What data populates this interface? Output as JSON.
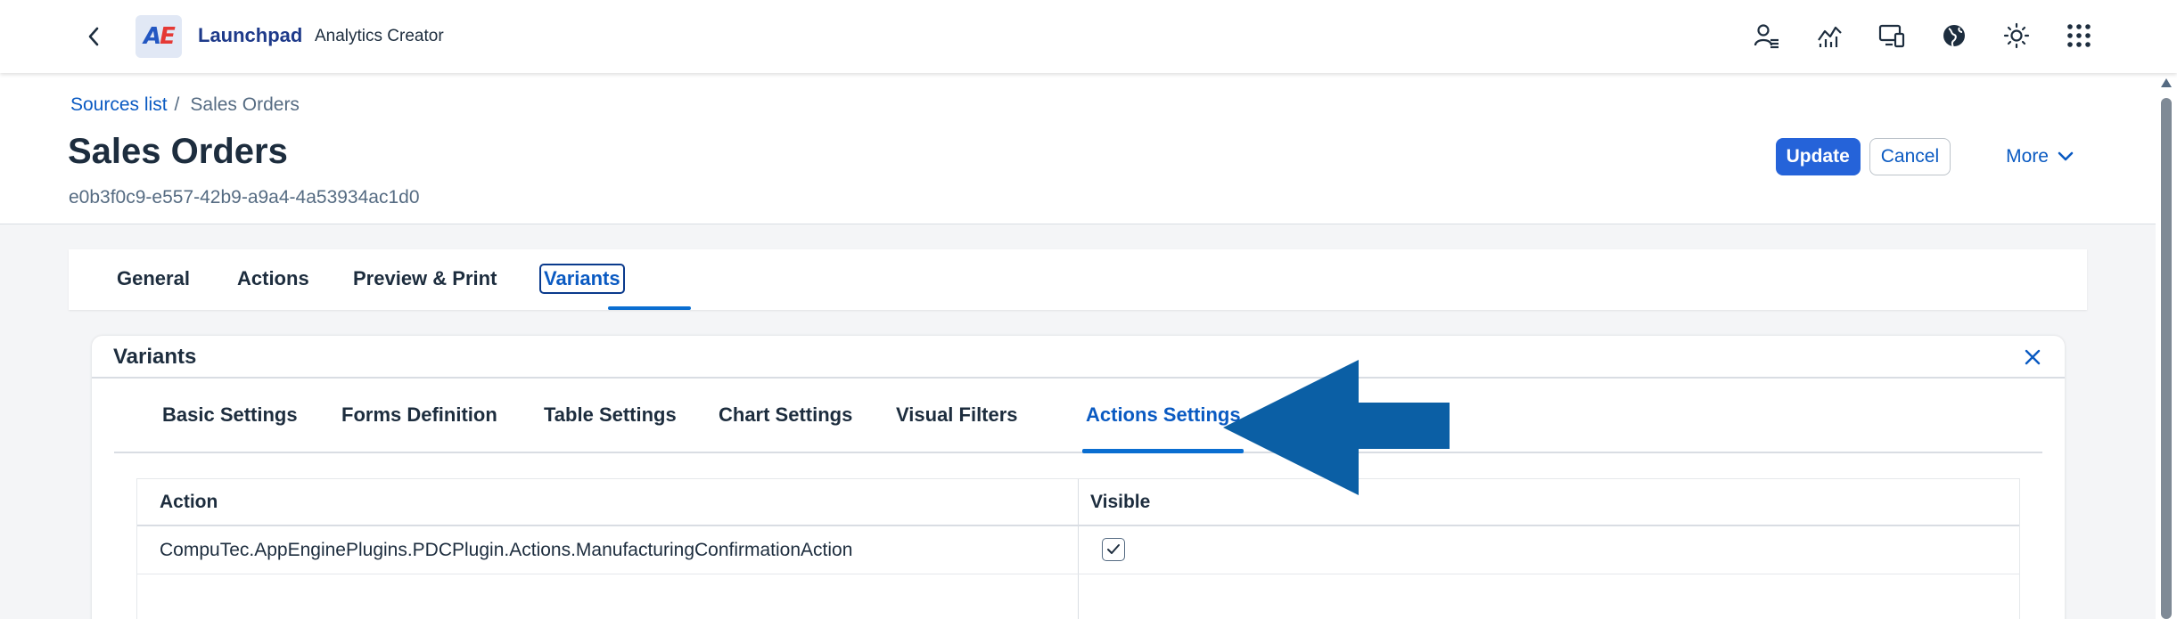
{
  "shell": {
    "logo_text_a": "A",
    "logo_text_e": "E",
    "app_title": "Launchpad",
    "app_subtitle": "Analytics Creator",
    "icons": [
      "user-settings-icon",
      "analytics-icon",
      "devices-icon",
      "globe-icon",
      "theme-icon",
      "app-grid-icon"
    ]
  },
  "header": {
    "breadcrumb_link": "Sources list",
    "breadcrumb_separator": "/",
    "breadcrumb_current": "Sales Orders",
    "title": "Sales Orders",
    "object_id": "e0b3f0c9-e557-42b9-a9a4-4a53934ac1d0",
    "update_label": "Update",
    "cancel_label": "Cancel",
    "more_label": "More"
  },
  "anchor_tabs": {
    "general": "General",
    "actions": "Actions",
    "preview_print": "Preview & Print",
    "variants": "Variants",
    "selected": "Variants"
  },
  "panel": {
    "title": "Variants",
    "subtabs": {
      "basic": "Basic Settings",
      "forms": "Forms Definition",
      "table": "Table Settings",
      "chart": "Chart Settings",
      "visual_filters": "Visual Filters",
      "actions_settings": "Actions Settings",
      "selected": "Actions Settings"
    },
    "table": {
      "col_action": "Action",
      "col_visible": "Visible",
      "rows": [
        {
          "action": "CompuTec.AppEnginePlugins.PDCPlugin.Actions.ManufacturingConfirmationAction",
          "visible": true
        }
      ]
    }
  },
  "colors": {
    "accent": "#0a6ed1",
    "link": "#0a5ac2",
    "arrow": "#0b5fa5",
    "text": "#1d2d3e"
  }
}
